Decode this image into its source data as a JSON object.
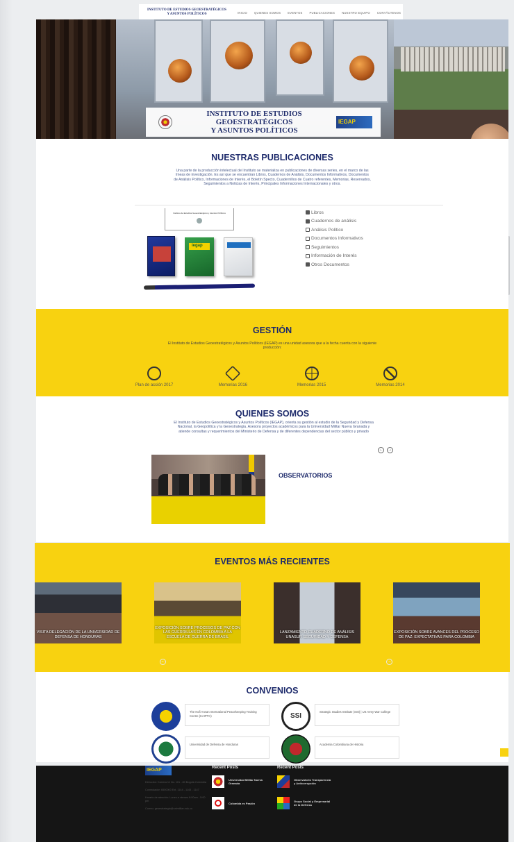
{
  "nav": {
    "brand_line1": "INSTITUTO DE ESTUDIOS GEOESTRATÉGICOS",
    "brand_line2": "Y ASUNTOS POLÍTICOS",
    "links": [
      "INICIO",
      "QUIENES SOMOS",
      "EVENTOS",
      "PUBLICACIONES",
      "NUESTRO EQUIPO",
      "CONTÁCTENOS"
    ]
  },
  "hero": {
    "banner_line1": "INSTITUTO DE ESTUDIOS GEOESTRATÉGICOS",
    "banner_line2": "Y ASUNTOS POLÍTICOS",
    "logo_text": "IEGAP"
  },
  "publicaciones": {
    "title": "NUESTRAS PUBLICACIONES",
    "description": "Una parte de la producción intelectual del Instituto se materializa en publicaciones de diversas series, en el marco de las líneas de investigación. Es así que se encuentran Libros, Cuadernos de Análisis, Documentos Informativos, Documentos de Análisis Político, Informaciones de Interés, el Boletín Specto, Cuadernillos de Cuatro referentes, Memorias, Reservados, Seguimientos a Noticias de Interés, Principales Informaciones Internacionales y otros.",
    "card_text": "Instituto de Estudios Geoestratégicos y Asuntos Políticos",
    "book2_text": "iegap",
    "items": [
      "Libros",
      "Cuadernos de análisis",
      "Análisis Político",
      "Documentos Informativos",
      "Seguimientos",
      "Información de Interés",
      "Otros Documentos"
    ]
  },
  "gestion": {
    "title": "GESTIÓN",
    "description": "El Instituto de Estudios Geoestratégicos y Asuntos Políticos (IEGAP) es una unidad asesora que a la fecha cuenta con la siguiente producción:",
    "items": [
      "Plan de acción 2017",
      "Memorias 2016",
      "Memorias 2015",
      "Memorias 2014"
    ]
  },
  "quienes": {
    "title": "QUIENES SOMOS",
    "description": "El Instituto de Estudios Geoestratégicos y Asuntos Políticos (IEGAP), orienta su gestión al estudio de la Seguridad y Defensa Nacional, la Geopolítica y la Geoestrategia. Asesora proyectos académicos para la Universidad Militar Nueva Granada y atiende consultas y requerimientos del Ministerio de Defensa y de diferentes dependencias del sector público y privado",
    "observatorios_title": "OBSERVATORIOS",
    "prev_symbol": "←",
    "next_symbol": "→"
  },
  "eventos": {
    "title": "EVENTOS MÁS RECIENTES",
    "items": [
      "VISITA DELEGACIÓN DE LA UNIVERSIDAD DE DEFENSA DE HONDURAS",
      "EXPOSICIÓN SOBRE PROCESOS DE PAZ CON LAS GUERRILLAS EN COLOMBIA A LA ESCUELA DE GUERRA DE BRASIL",
      "LANZAMIENTO CUADERNO DE ANÁLISIS UNASUR SEGURIDAD Y DEFENSA",
      "EXPOSICIÓN SOBRE AVANCES DEL PROCESO DE PAZ: EXPECTATIVAS PARA COLOMBIA"
    ],
    "prev_symbol": "←",
    "next_symbol": "→"
  },
  "convenios": {
    "title": "CONVENIOS",
    "items": [
      "The Kofi Annan International Peacekeeping Training Centre (KAIPTC)",
      "Strategic Studies Institute (SSI) | US Army War College",
      "Universidad de Defensa de Honduras",
      "Academia Colombiana de Historia"
    ],
    "ssi_text": "SSI"
  },
  "footer": {
    "logo_text": "IEGAP",
    "address_lines": [
      "Dirección: Carrera 11 No. 101 - 80 Bogotá Colombia",
      "Conmutador: 6500000 Ext. 1144 - 1145 - 1147",
      "Horario de atención: Lunes a viernes 8:00am - 5:00 pm",
      "Correo: geoestrategia@unimilitar.edu.co"
    ],
    "col1_title": "Recent Posts",
    "col2_title": "Recent Posts",
    "col1_posts": [
      "Universidad Militar Nueva Granada",
      "Colombia es Pasión"
    ],
    "col2_posts": [
      "Observatorio Transparencia y Anticorrupción",
      "Grupo Social y Empresarial de la Defensa"
    ]
  },
  "colors": {
    "brand_blue": "#1d2a6b",
    "accent_yellow": "#f8d210",
    "footer_bg": "#151515"
  }
}
